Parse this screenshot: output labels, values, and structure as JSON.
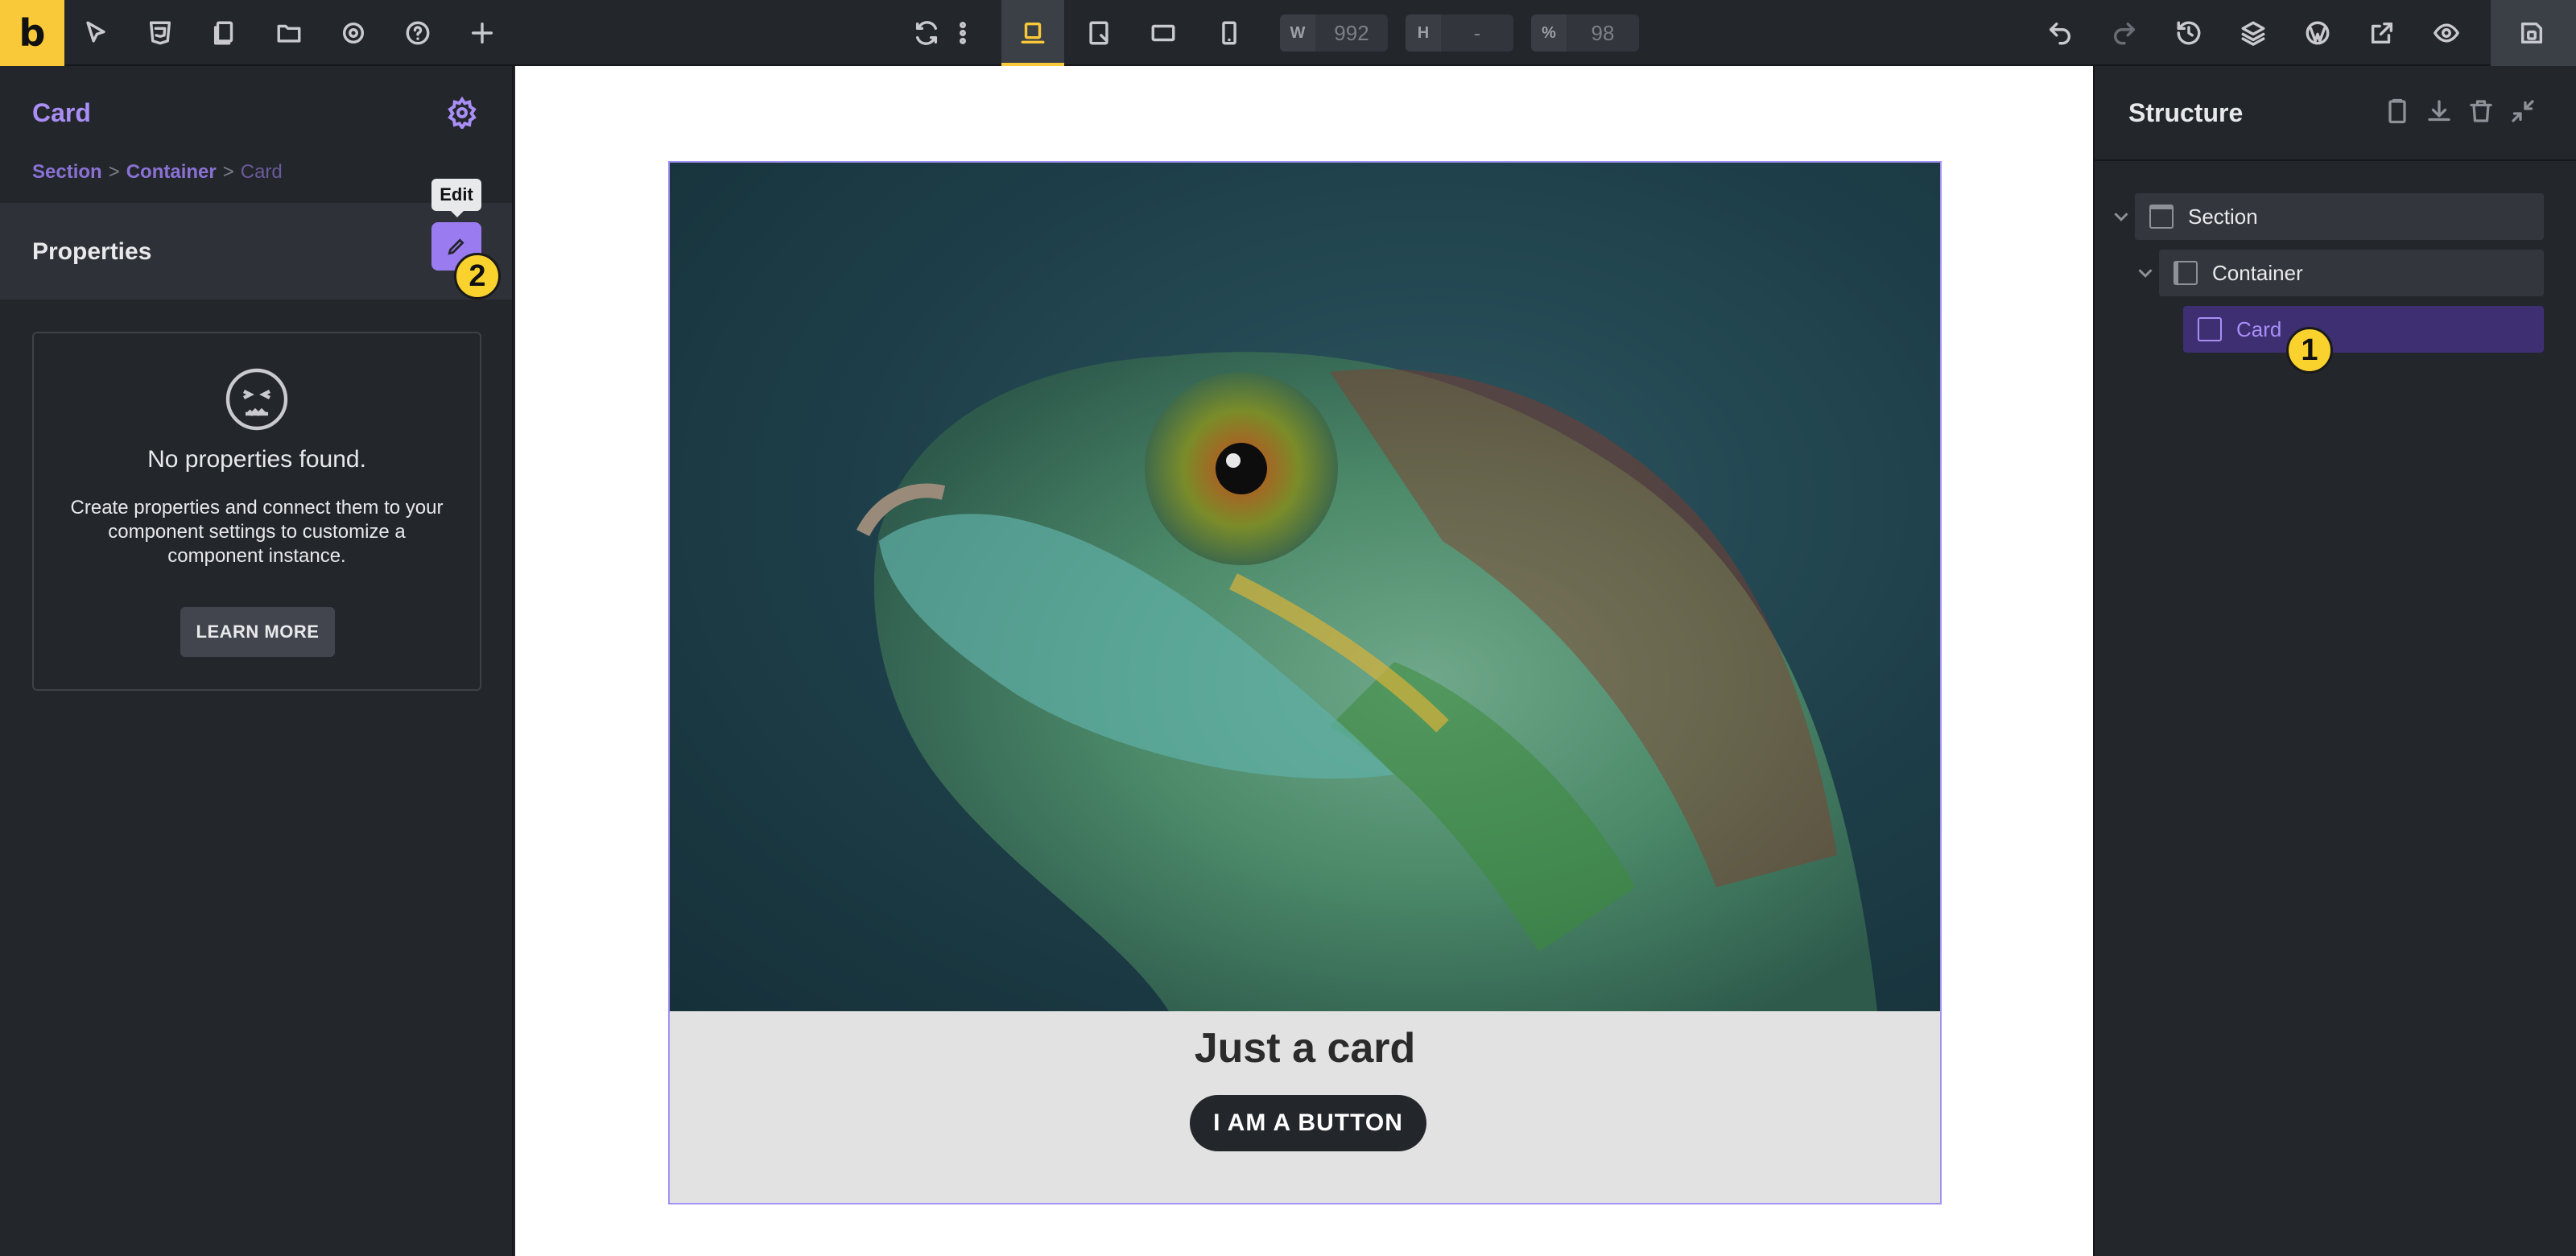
{
  "topbar": {
    "logo": "b",
    "width_label": "W",
    "width_value": "992",
    "height_label": "H",
    "height_value": "-",
    "percent_label": "%",
    "percent_value": "98",
    "accent": "#f9c93a"
  },
  "left_panel": {
    "title": "Card",
    "breadcrumb": [
      "Section",
      "Container",
      "Card"
    ],
    "breadcrumb_sep": ">",
    "properties_title": "Properties",
    "edit_tooltip": "Edit",
    "empty_title": "No properties found.",
    "empty_desc": "Create properties and connect them to your component settings to customize a component instance.",
    "learn_more": "LEARN MORE",
    "accent": "#9b7bf0"
  },
  "canvas": {
    "card_title": "Just a card",
    "card_button": "I AM A BUTTON"
  },
  "structure": {
    "title": "Structure",
    "items": [
      {
        "label": "Section",
        "level": 0
      },
      {
        "label": "Container",
        "level": 1
      },
      {
        "label": "Card",
        "level": 2,
        "selected": true
      }
    ]
  },
  "badges": [
    "1",
    "2"
  ]
}
